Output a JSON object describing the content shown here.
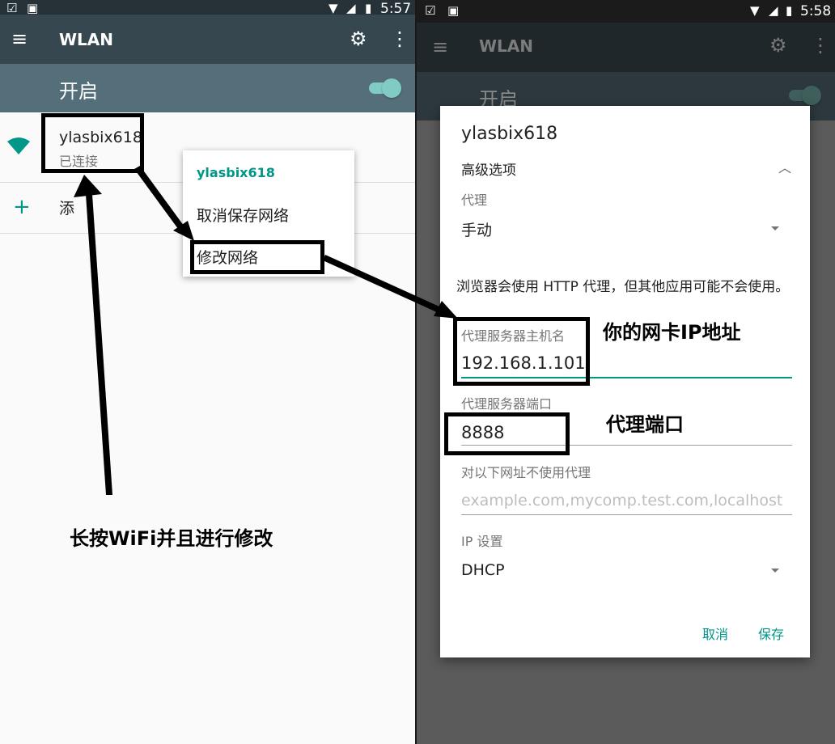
{
  "left": {
    "status": {
      "time": "5:57"
    },
    "toolbar": {
      "title": "WLAN"
    },
    "switchbar": {
      "label": "开启"
    },
    "network": {
      "name": "ylasbix618",
      "status": "已连接"
    },
    "add_network": {
      "label": "添加网络",
      "visible_label": "添"
    },
    "popup": {
      "title": "ylasbix618",
      "items": [
        "取消保存网络",
        "修改网络"
      ]
    },
    "annotation": "长按WiFi并且进行修改"
  },
  "right": {
    "status": {
      "time": "5:58"
    },
    "toolbar": {
      "title": "WLAN"
    },
    "switchbar": {
      "label": "开启"
    },
    "dialog": {
      "title": "ylasbix618",
      "advanced_label": "高级选项",
      "proxy_label": "代理",
      "proxy_value": "手动",
      "message": "浏览器会使用 HTTP 代理，但其他应用可能不会使用。",
      "host_label": "代理服务器主机名",
      "host_value": "192.168.1.101",
      "port_label": "代理服务器端口",
      "port_value": "8888",
      "bypass_label": "对以下网址不使用代理",
      "bypass_placeholder": "example.com,mycomp.test.com,localhost",
      "ip_label": "IP 设置",
      "ip_value": "DHCP",
      "cancel": "取消",
      "save": "保存"
    },
    "annotations": {
      "host": "你的网卡IP地址",
      "port": "代理端口"
    }
  },
  "colors": {
    "accent": "#009688",
    "toolbar": "#37474f",
    "statusbar": "#263238",
    "switchbar": "#546e7a"
  }
}
